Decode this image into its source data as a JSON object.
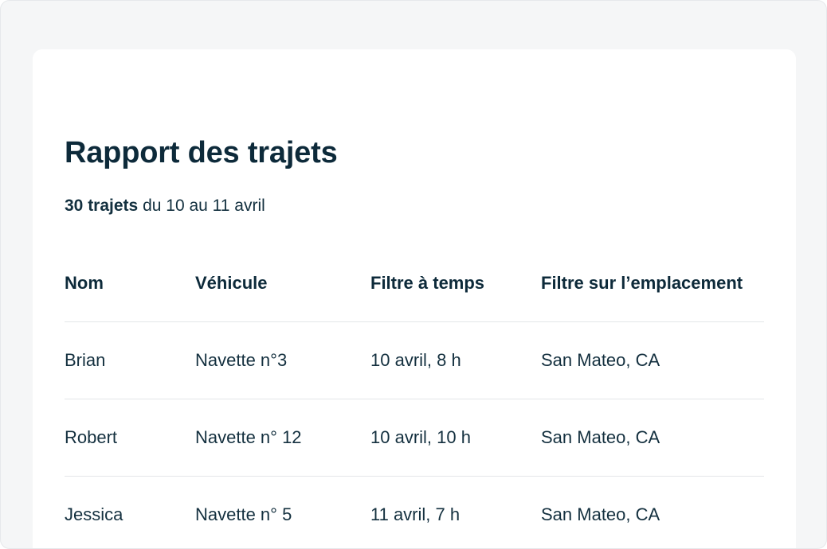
{
  "report": {
    "title": "Rapport des trajets",
    "summary_count": "30 trajets",
    "summary_range": " du 10 au 11 avril"
  },
  "table": {
    "columns": [
      "Nom",
      "Véhicule",
      "Filtre à temps",
      "Filtre sur l’emplacement"
    ],
    "rows": [
      [
        "Brian",
        "Navette n°3",
        "10 avril, 8 h",
        "San Mateo, CA"
      ],
      [
        "Robert",
        "Navette n° 12",
        "10 avril, 10 h",
        "San Mateo, CA"
      ],
      [
        "Jessica",
        "Navette n° 5",
        "11 avril, 7 h",
        "San Mateo, CA"
      ]
    ]
  }
}
